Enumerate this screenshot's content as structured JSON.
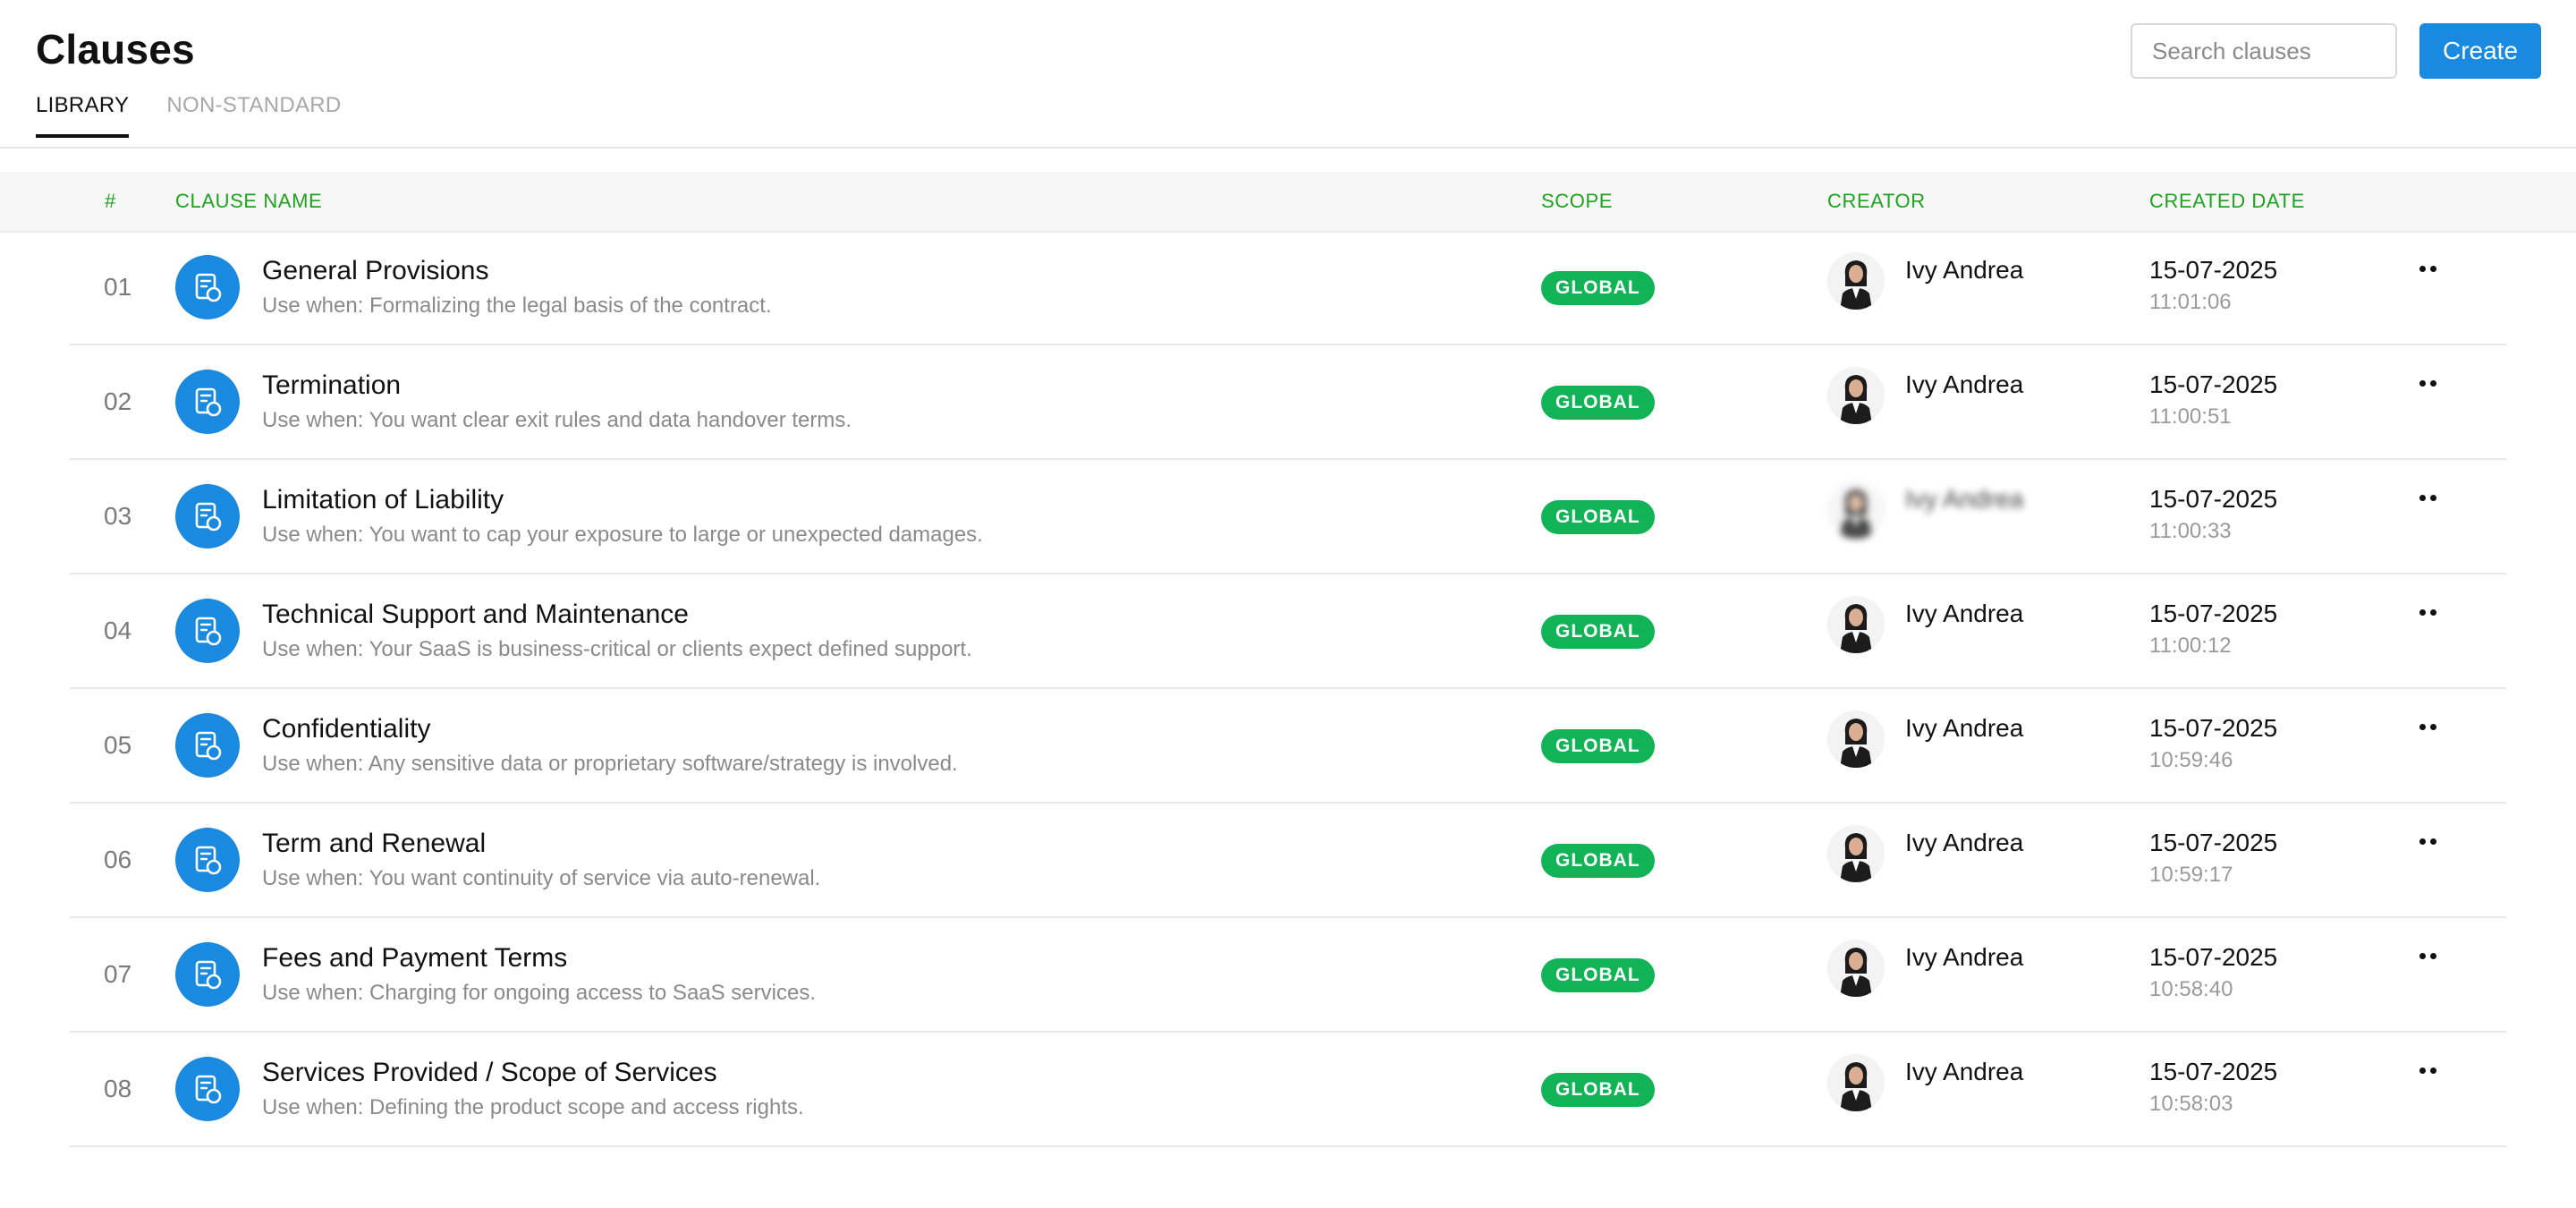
{
  "header": {
    "title": "Clauses",
    "tabs": [
      {
        "label": "LIBRARY",
        "active": true
      },
      {
        "label": "NON-STANDARD",
        "active": false
      }
    ],
    "search": {
      "placeholder": "Search clauses",
      "value": ""
    },
    "create_label": "Create"
  },
  "table": {
    "columns": {
      "num": "#",
      "name": "CLAUSE NAME",
      "scope": "SCOPE",
      "creator": "CREATOR",
      "created": "CREATED DATE"
    },
    "rows": [
      {
        "num": "01",
        "title": "General Provisions",
        "desc": "Use when: Formalizing the legal basis of the contract.",
        "scope": "GLOBAL",
        "creator": "Ivy Andrea",
        "date": "15-07-2025",
        "time": "11:01:06",
        "blurred": false
      },
      {
        "num": "02",
        "title": "Termination",
        "desc": "Use when: You want clear exit rules and data handover terms.",
        "scope": "GLOBAL",
        "creator": "Ivy Andrea",
        "date": "15-07-2025",
        "time": "11:00:51",
        "blurred": false
      },
      {
        "num": "03",
        "title": "Limitation of Liability",
        "desc": "Use when: You want to cap your exposure to large or unexpected damages.",
        "scope": "GLOBAL",
        "creator": "Ivy Andrea",
        "date": "15-07-2025",
        "time": "11:00:33",
        "blurred": true
      },
      {
        "num": "04",
        "title": "Technical Support and Maintenance",
        "desc": "Use when: Your SaaS is business-critical or clients expect defined support.",
        "scope": "GLOBAL",
        "creator": "Ivy Andrea",
        "date": "15-07-2025",
        "time": "11:00:12",
        "blurred": false
      },
      {
        "num": "05",
        "title": "Confidentiality",
        "desc": "Use when: Any sensitive data or proprietary software/strategy is involved.",
        "scope": "GLOBAL",
        "creator": "Ivy Andrea",
        "date": "15-07-2025",
        "time": "10:59:46",
        "blurred": false
      },
      {
        "num": "06",
        "title": "Term and Renewal",
        "desc": "Use when: You want continuity of service via auto-renewal.",
        "scope": "GLOBAL",
        "creator": "Ivy Andrea",
        "date": "15-07-2025",
        "time": "10:59:17",
        "blurred": false
      },
      {
        "num": "07",
        "title": "Fees and Payment Terms",
        "desc": "Use when: Charging for ongoing access to SaaS services.",
        "scope": "GLOBAL",
        "creator": "Ivy Andrea",
        "date": "15-07-2025",
        "time": "10:58:40",
        "blurred": false
      },
      {
        "num": "08",
        "title": "Services Provided / Scope of Services",
        "desc": "Use when: Defining the product scope and access rights.",
        "scope": "GLOBAL",
        "creator": "Ivy Andrea",
        "date": "15-07-2025",
        "time": "10:58:03",
        "blurred": false
      }
    ]
  },
  "icons": {
    "search": "search-icon",
    "clause": "document-shield-icon",
    "more": "more-horizontal-icon",
    "avatar": "person-avatar"
  },
  "colors": {
    "accent": "#1a8ae0",
    "header_label": "#1ea31e",
    "badge": "#12b357"
  }
}
